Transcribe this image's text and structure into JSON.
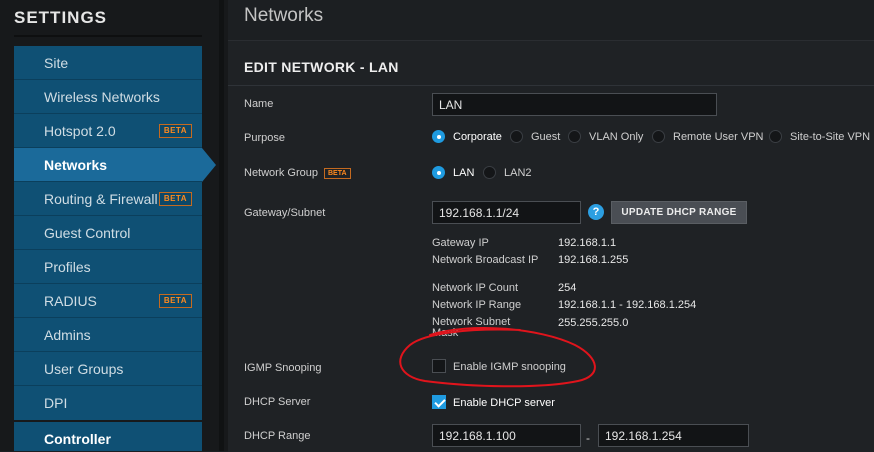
{
  "sidebar": {
    "title": "SETTINGS",
    "items": [
      {
        "label": "Site",
        "badge": ""
      },
      {
        "label": "Wireless Networks",
        "badge": ""
      },
      {
        "label": "Hotspot 2.0",
        "badge": "BETA"
      },
      {
        "label": "Networks",
        "badge": "",
        "active": true
      },
      {
        "label": "Routing & Firewall",
        "badge": "BETA"
      },
      {
        "label": "Guest Control",
        "badge": ""
      },
      {
        "label": "Profiles",
        "badge": ""
      },
      {
        "label": "RADIUS",
        "badge": "BETA"
      },
      {
        "label": "Admins",
        "badge": ""
      },
      {
        "label": "User Groups",
        "badge": ""
      },
      {
        "label": "DPI",
        "badge": ""
      }
    ],
    "controller": "Controller"
  },
  "main": {
    "page_title": "Networks",
    "heading": "EDIT NETWORK - LAN",
    "name": {
      "label": "Name",
      "value": "LAN"
    },
    "purpose": {
      "label": "Purpose",
      "options": [
        "Corporate",
        "Guest",
        "VLAN Only",
        "Remote User VPN",
        "Site-to-Site VPN"
      ],
      "selected": "Corporate"
    },
    "network_group": {
      "label": "Network Group",
      "badge": "BETA",
      "options": [
        "LAN",
        "LAN2"
      ],
      "selected": "LAN"
    },
    "gateway": {
      "label": "Gateway/Subnet",
      "value": "192.168.1.1/24",
      "help_icon": "?",
      "button": "UPDATE DHCP RANGE"
    },
    "info": [
      {
        "label": "Gateway IP",
        "value": "192.168.1.1"
      },
      {
        "label": "Network Broadcast IP",
        "value": "192.168.1.255"
      },
      {
        "label": "Network IP Count",
        "value": "254"
      },
      {
        "label": "Network IP Range",
        "value": "192.168.1.1 - 192.168.1.254"
      },
      {
        "label": "Network Subnet Mask",
        "value": "255.255.255.0"
      }
    ],
    "igmp": {
      "label": "IGMP Snooping",
      "checkbox": "Enable IGMP snooping",
      "checked": false
    },
    "dhcp_server": {
      "label": "DHCP Server",
      "checkbox": "Enable DHCP server",
      "checked": true
    },
    "dhcp_range": {
      "label": "DHCP Range",
      "start": "192.168.1.100",
      "separator": "-",
      "end": "192.168.1.254"
    }
  },
  "colors": {
    "accent": "#1f9be0",
    "sidebar_bg": "#0f5074",
    "sidebar_active": "#1b6a9a",
    "beta": "#ff8a1e",
    "annotation": "#e0141c"
  }
}
